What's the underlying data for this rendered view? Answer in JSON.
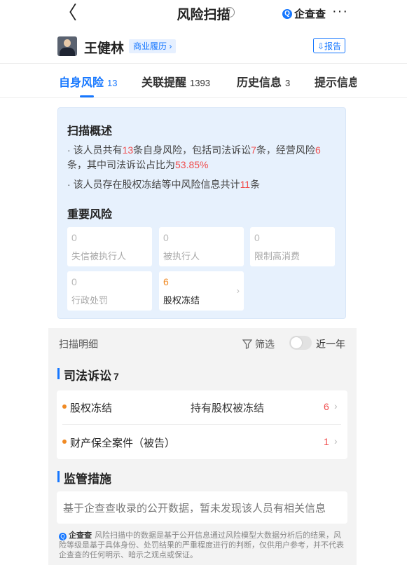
{
  "nav": {
    "back_glyph": "〈",
    "title": "风险扫描",
    "brand": "企查查",
    "more": "···"
  },
  "person": {
    "name": "王健林",
    "tag": "商业履历 ›",
    "report_label": "⇩报告"
  },
  "tabs": [
    {
      "label": "自身风险",
      "count": "13",
      "active": true
    },
    {
      "label": "关联提醒",
      "count": "1393",
      "active": false
    },
    {
      "label": "历史信息",
      "count": "3",
      "active": false
    },
    {
      "label": "提示信息",
      "count": "",
      "active": false
    }
  ],
  "summary": {
    "title": "扫描概述",
    "bullet1": {
      "a": "该人员共有",
      "b": "13",
      "c": "条自身风险，包括司法诉讼",
      "d": "7",
      "e": "条，经营风险",
      "f": "6",
      "g": "条，其中司法诉讼占比为",
      "h": "53.85%"
    },
    "bullet2": {
      "a": "该人员存在股权冻结等中风险信息共计",
      "b": "11",
      "c": "条"
    },
    "important_title": "重要风险",
    "risks": [
      {
        "num": "0",
        "label": "失信被执行人"
      },
      {
        "num": "0",
        "label": "被执行人"
      },
      {
        "num": "0",
        "label": "限制高消费"
      },
      {
        "num": "0",
        "label": "行政处罚"
      },
      {
        "num": "6",
        "label": "股权冻结"
      }
    ]
  },
  "detail": {
    "title": "扫描明细",
    "filter_label": "筛选",
    "toggle_label": "近一年",
    "toggle_on": false
  },
  "judicial": {
    "title": "司法诉讼",
    "count": "7",
    "rows": [
      {
        "label": "股权冻结",
        "desc": "持有股权被冻结",
        "num": "6"
      },
      {
        "label": "财产保全案件（被告）",
        "desc": "",
        "num": "1"
      }
    ]
  },
  "regulatory": {
    "title": "监管措施",
    "empty_text": "基于企查查收录的公开数据，暂未发现该人员有相关信息"
  },
  "footer": {
    "brand": "企查查",
    "text": "风险扫描中的数据是基于公开信息通过风险模型大数据分析后的结果，风险等级是基于具体身份、处罚结果的严重程度进行的判断，仅供用户参考，并不代表企查查的任何明示、暗示之观点或保证。"
  },
  "colors": {
    "accent": "#1677ff",
    "risk_red": "#f04f4f",
    "warn_orange": "#f08a24",
    "summary_bg": "#e7f1fd"
  }
}
